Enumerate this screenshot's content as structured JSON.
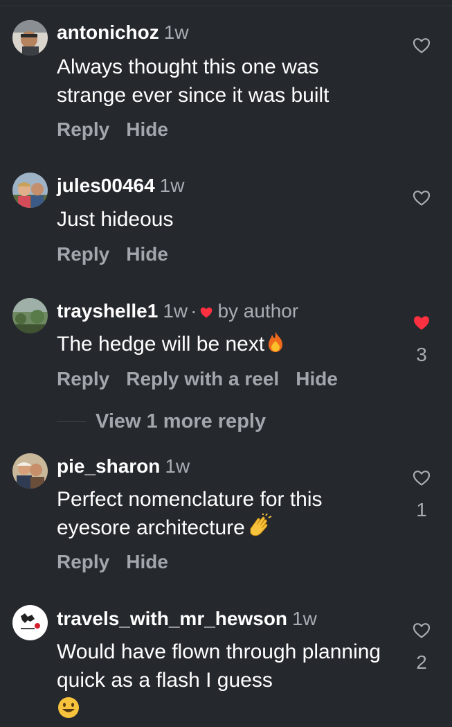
{
  "colors": {
    "background": "#25282d",
    "text": "#ffffff",
    "muted": "#a9adb4",
    "heart_red": "#ff3040"
  },
  "comments": [
    {
      "username": "antonichoz",
      "time": "1w",
      "text": "Always thought this one was strange ever since it was built",
      "actions": [
        "Reply",
        "Hide"
      ],
      "liked": false,
      "like_count": ""
    },
    {
      "username": "jules00464",
      "time": "1w",
      "text": "Just hideous",
      "actions": [
        "Reply",
        "Hide"
      ],
      "liked": false,
      "like_count": ""
    },
    {
      "username": "trayshelle1",
      "time": "1w",
      "separator": "·",
      "author_badge": "by author",
      "text": "The hedge will be next",
      "emoji": "fire",
      "actions": [
        "Reply",
        "Reply with a reel",
        "Hide"
      ],
      "liked": true,
      "like_count": "3"
    },
    {
      "username": "pie_sharon",
      "time": "1w",
      "text": "Perfect nomenclature for this eyesore architecture",
      "emoji": "clapping-hands",
      "actions": [
        "Reply",
        "Hide"
      ],
      "liked": false,
      "like_count": "1"
    },
    {
      "username": "travels_with_mr_hewson",
      "time": "1w",
      "text": "Would have flown through planning quick as a flash I guess",
      "emoji": "grinning-face",
      "actions": [],
      "liked": false,
      "like_count": "2"
    }
  ],
  "view_more_replies": "View 1 more reply"
}
